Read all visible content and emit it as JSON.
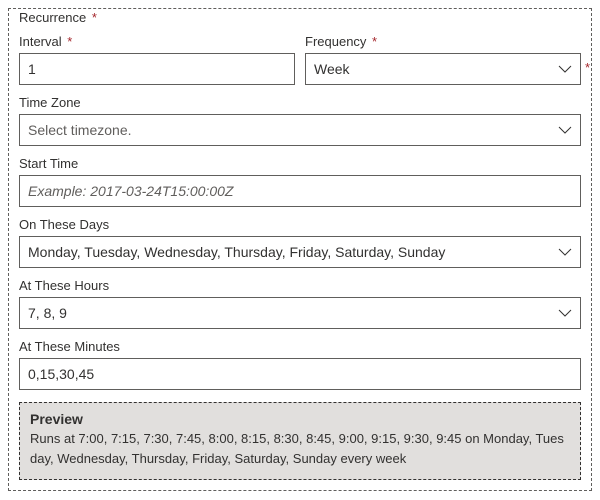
{
  "panel": {
    "title": "Recurrence",
    "interval": {
      "label": "Interval",
      "value": "1"
    },
    "frequency": {
      "label": "Frequency",
      "value": "Week"
    },
    "timezone": {
      "label": "Time Zone",
      "placeholder": "Select timezone."
    },
    "starttime": {
      "label": "Start Time",
      "placeholder": "Example: 2017-03-24T15:00:00Z"
    },
    "days": {
      "label": "On These Days",
      "value": "Monday, Tuesday, Wednesday, Thursday, Friday, Saturday, Sunday"
    },
    "hours": {
      "label": "At These Hours",
      "value": "7, 8, 9"
    },
    "minutes": {
      "label": "At These Minutes",
      "value": "0,15,30,45"
    },
    "preview": {
      "title": "Preview",
      "text": "Runs at 7:00, 7:15, 7:30, 7:45, 8:00, 8:15, 8:30, 8:45, 9:00, 9:15, 9:30, 9:45 on Monday, Tuesday, Wednesday, Thursday, Friday, Saturday, Sunday every week"
    }
  },
  "asterisk": "*"
}
